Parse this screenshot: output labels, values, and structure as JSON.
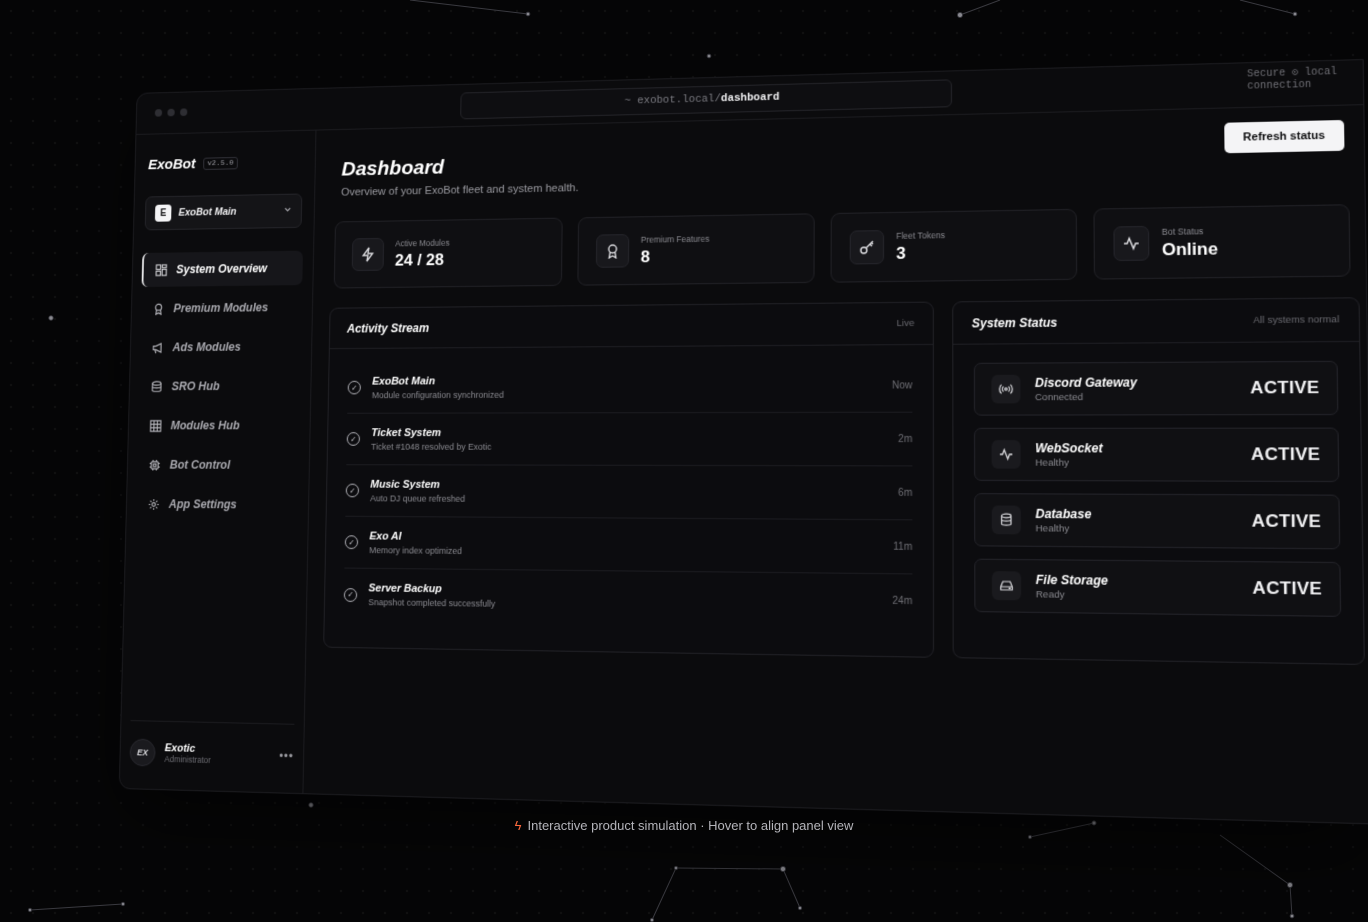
{
  "window": {
    "url_prefix": "~ exobot.local/",
    "url_path": "dashboard",
    "secure_note": "Secure ⊙ local connection"
  },
  "sidebar": {
    "brand": "ExoBot",
    "version": "v2.5.0",
    "bot_selector": {
      "avatar": "E",
      "label": "ExoBot Main"
    },
    "items": [
      {
        "label": "System Overview",
        "icon": "grid-icon",
        "active": true
      },
      {
        "label": "Premium Modules",
        "icon": "award-icon",
        "active": false
      },
      {
        "label": "Ads Modules",
        "icon": "megaphone-icon",
        "active": false
      },
      {
        "label": "SRO Hub",
        "icon": "database-icon",
        "active": false
      },
      {
        "label": "Modules Hub",
        "icon": "table-grid-icon",
        "active": false
      },
      {
        "label": "Bot Control",
        "icon": "cpu-icon",
        "active": false
      },
      {
        "label": "App Settings",
        "icon": "gear-icon",
        "active": false
      }
    ],
    "user": {
      "initials": "EX",
      "name": "Exotic",
      "role": "Administrator"
    }
  },
  "header": {
    "title": "Dashboard",
    "subtitle": "Overview of your ExoBot fleet and system health.",
    "refresh_label": "Refresh status"
  },
  "stats": [
    {
      "label": "Active Modules",
      "value": "24 / 28",
      "icon": "bolt-icon"
    },
    {
      "label": "Premium Features",
      "value": "8",
      "icon": "award-icon"
    },
    {
      "label": "Fleet Tokens",
      "value": "3",
      "icon": "key-icon"
    },
    {
      "label": "Bot Status",
      "value": "Online",
      "icon": "pulse-icon"
    }
  ],
  "activity": {
    "title": "Activity Stream",
    "meta": "Live",
    "items": [
      {
        "title": "ExoBot Main",
        "detail": "Module configuration synchronized",
        "time": "Now"
      },
      {
        "title": "Ticket System",
        "detail": "Ticket #1048 resolved by Exotic",
        "time": "2m"
      },
      {
        "title": "Music System",
        "detail": "Auto DJ queue refreshed",
        "time": "6m"
      },
      {
        "title": "Exo AI",
        "detail": "Memory index optimized",
        "time": "11m"
      },
      {
        "title": "Server Backup",
        "detail": "Snapshot completed successfully",
        "time": "24m"
      }
    ]
  },
  "system_status": {
    "title": "System Status",
    "meta": "All systems normal",
    "items": [
      {
        "name": "Discord Gateway",
        "detail": "Connected",
        "state": "ACTIVE",
        "icon": "broadcast-icon"
      },
      {
        "name": "WebSocket",
        "detail": "Healthy",
        "state": "ACTIVE",
        "icon": "pulse-icon"
      },
      {
        "name": "Database",
        "detail": "Healthy",
        "state": "ACTIVE",
        "icon": "database-icon"
      },
      {
        "name": "File Storage",
        "detail": "Ready",
        "state": "ACTIVE",
        "icon": "drive-icon"
      }
    ]
  },
  "caption": "Interactive product simulation · Hover to align panel view",
  "colors": {
    "accent": "#ff6a3d",
    "background": "#050506",
    "panel": "#0c0c0f"
  }
}
